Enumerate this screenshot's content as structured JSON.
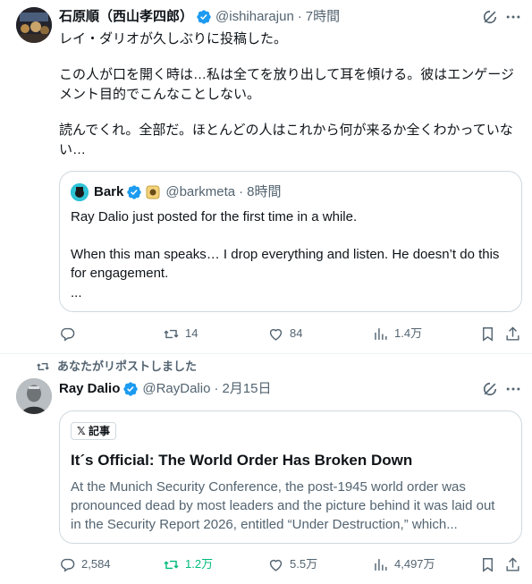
{
  "post1": {
    "author_name": "石原順（西山孝四郎）",
    "handle": "@ishiharajun",
    "separator": "·",
    "time": "7時間",
    "icons": {
      "verified": "verified-badge-icon",
      "grok": "grok-icon",
      "more": "more-icon"
    },
    "text_lines": [
      "レイ・ダリオが久しぶりに投稿した。",
      "この人が口を開く時は…私は全てを放り出して耳を傾ける。彼はエンゲージ",
      "メント目的でこんなことしない。",
      "読んでくれ。全部だ。ほとんどの人はこれから何が来るか全くわかっていな",
      "い…"
    ],
    "quote": {
      "author_name": "Bark",
      "handle": "@barkmeta",
      "separator": "·",
      "time": "8時間",
      "text_lines": [
        "Ray Dalio just posted for the first time in a while.",
        "When this man speaks… I drop everything and listen. He doesn’t do this",
        "for engagement.",
        "..."
      ]
    },
    "actions": {
      "reply": "",
      "repost": "14",
      "like": "84",
      "views": "1.4万"
    }
  },
  "repost_context": "あなたがリポストしました",
  "post2": {
    "author_name": "Ray Dalio",
    "handle": "@RayDalio",
    "separator": "·",
    "time": "2月15日",
    "article": {
      "tag": "𝕏 記事",
      "title": "It´s Official: The World Order Has Broken Down",
      "lines": [
        "At the Munich Security Conference, the post-1945 world order was",
        "pronounced dead by most leaders and the picture behind it was laid out",
        "in the Security Report 2026, entitled “Under Destruction,” which..."
      ]
    },
    "actions": {
      "reply": "2,584",
      "repost": "1.2万",
      "like": "5.5万",
      "views": "4,497万"
    }
  },
  "colors": {
    "accent": "#1d9bf0",
    "text": "#0f1419",
    "muted": "#536471",
    "repost_active": "#00ba7c",
    "border": "#cfd9de"
  }
}
